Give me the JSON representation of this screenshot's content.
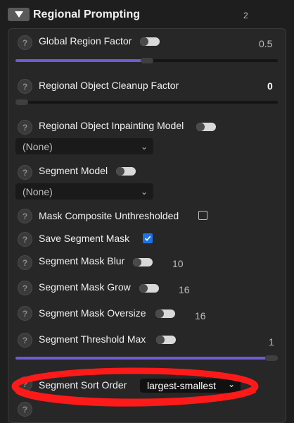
{
  "header": {
    "title": "Regional Prompting",
    "count": "2"
  },
  "rows": {
    "global_region_factor": {
      "label": "Global Region Factor",
      "value": "0.5",
      "fill_fraction": 0.5
    },
    "cleanup_factor": {
      "label": "Regional Object Cleanup Factor",
      "value": "0",
      "fill_fraction": 0
    },
    "inpainting_model": {
      "label": "Regional Object Inpainting Model",
      "selected": "(None)"
    },
    "segment_model": {
      "label": "Segment Model",
      "selected": "(None)"
    },
    "mask_composite": {
      "label": "Mask Composite Unthresholded",
      "checked": false
    },
    "save_segment_mask": {
      "label": "Save Segment Mask",
      "checked": true
    },
    "segment_mask_blur": {
      "label": "Segment Mask Blur",
      "value": "10"
    },
    "segment_mask_grow": {
      "label": "Segment Mask Grow",
      "value": "16"
    },
    "segment_mask_oversize": {
      "label": "Segment Mask Oversize",
      "value": "16"
    },
    "segment_threshold_max": {
      "label": "Segment Threshold Max",
      "value": "1",
      "fill_fraction": 1
    },
    "segment_sort_order": {
      "label": "Segment Sort Order",
      "selected": "largest-smallest"
    }
  },
  "icons": {
    "help": "question-mark",
    "collapse": "triangle-down",
    "dropdown": "chevron-down",
    "check": "checkmark"
  },
  "colors": {
    "accent": "#6f5bd8",
    "checkbox": "#1a73e8",
    "highlight": "#ff1a1a"
  }
}
